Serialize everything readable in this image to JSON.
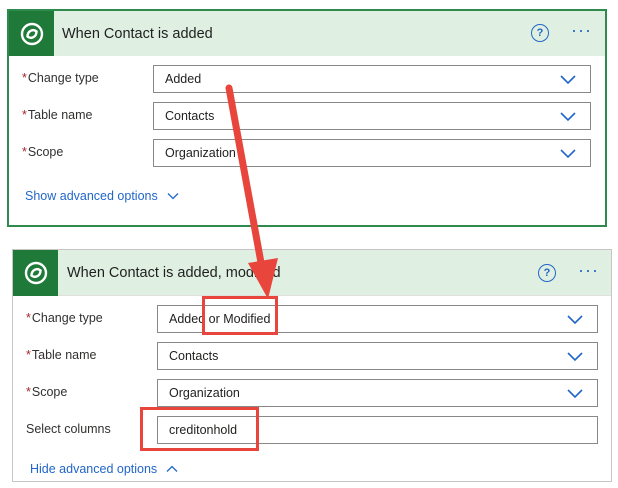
{
  "card1": {
    "title": "When Contact is added",
    "help_label": "?",
    "more_label": "···",
    "fields": [
      {
        "label": "Change type",
        "value": "Added"
      },
      {
        "label": "Table name",
        "value": "Contacts"
      },
      {
        "label": "Scope",
        "value": "Organization"
      }
    ],
    "advanced_link": "Show advanced options"
  },
  "card2": {
    "title": "When Contact is added, modified",
    "help_label": "?",
    "more_label": "···",
    "fields": [
      {
        "label": "Change type",
        "value": "Added or Modified"
      },
      {
        "label": "Table name",
        "value": "Contacts"
      },
      {
        "label": "Scope",
        "value": "Organization"
      }
    ],
    "select_columns": {
      "label": "Select columns",
      "value": "creditonhold"
    },
    "advanced_link": "Hide advanced options"
  },
  "colors": {
    "accent_green": "#1f7a3a",
    "header_bg": "#dff0e3",
    "link_blue": "#2266c8",
    "annotation_red": "#e8453c",
    "required_red": "#a4262c"
  },
  "icons": {
    "app_icon": "dataverse-icon",
    "dropdown_icon": "chevron-down-icon",
    "collapse_icon": "chevron-up-icon",
    "help_icon": "help-circle-icon",
    "more_icon": "ellipsis-icon"
  }
}
